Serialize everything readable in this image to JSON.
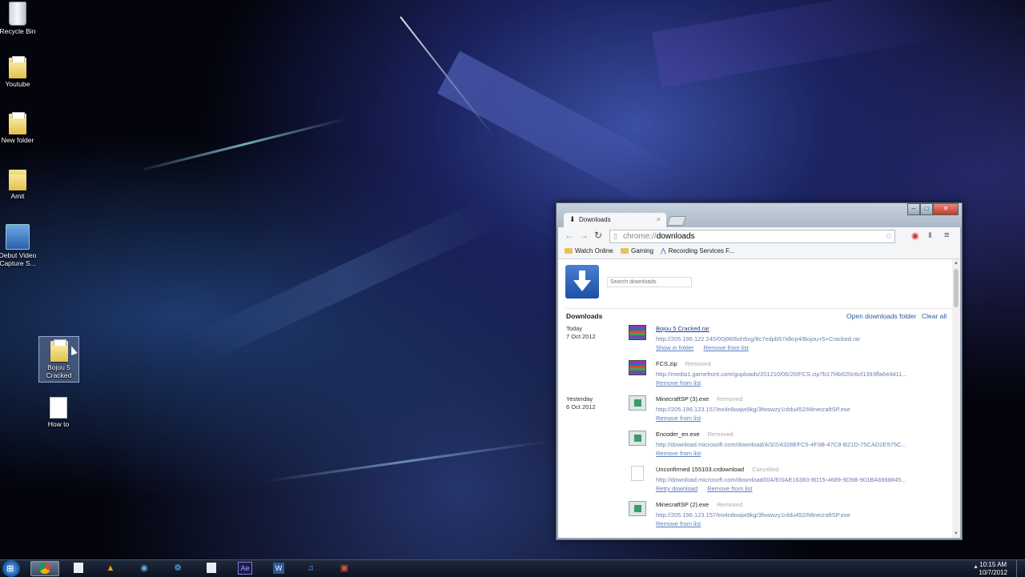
{
  "desktop": {
    "icons": [
      {
        "label": "Recycle Bin"
      },
      {
        "label": "Youtube"
      },
      {
        "label": "New folder"
      },
      {
        "label": "Amit"
      },
      {
        "label": "Debut Video Capture S..."
      },
      {
        "label": "Bojou 5 Cracked"
      },
      {
        "label": "How to"
      }
    ]
  },
  "browser": {
    "tab_title": "Downloads",
    "url_scheme": "chrome://",
    "url_path": "downloads",
    "bookmarks": [
      "Watch Online",
      "Gaming",
      "Recording Services F..."
    ],
    "search_placeholder": "Search downloads",
    "header_title": "Downloads",
    "open_folder": "Open downloads folder",
    "clear_all": "Clear all",
    "days": [
      {
        "label": "Today",
        "date": "7 Oct 2012"
      },
      {
        "label": "Yesterday",
        "date": "6 Oct 2012"
      }
    ],
    "items": [
      {
        "name": "Bojou 5 Cracked.rar",
        "status": "",
        "url": "http://205.196.122.245/00j9t06oh6xg/8c7edpb57idkrp4/Bojou+5+Cracked.rar",
        "actions": [
          "Show in folder",
          "Remove from list"
        ],
        "icon": "rar-icon"
      },
      {
        "name": "FCS.zip",
        "status": "Removed",
        "url": "http://media1.gamefront.com/guploads/201210/06/20/FCS.zip?b17f4b620c6cf1393ffa644d11...",
        "actions": [
          "Remove from list"
        ],
        "icon": "rar-icon"
      },
      {
        "name": "MinecraftSP (3).exe",
        "status": "Removed",
        "url": "http://205.196.123.157/eo4n8oajw9kg/3fwswzy1nldu452/MinecraftSP.exe",
        "actions": [
          "Remove from list"
        ],
        "icon": "exe-icon"
      },
      {
        "name": "Encoder_en.exe",
        "status": "Removed",
        "url": "http://download.microsoft.com/download/4/3/2/4328EFC5-4F3B-47C8-B21D-75CAD2E575C...",
        "actions": [
          "Remove from list"
        ],
        "icon": "exe-icon"
      },
      {
        "name": "Unconfirmed 155103.crdownload",
        "status": "Cancelled",
        "url": "http://download.microsoft.com/download/0/A/E/0AE16383-8D15-4689-9D9B-901BA6968845...",
        "actions": [
          "Retry download",
          "Remove from list"
        ],
        "icon": "blank-file-icon"
      },
      {
        "name": "MinecraftSP (2).exe",
        "status": "Removed",
        "url": "http://205.196.123.157/eo4n8oajw9kg/3fwswzy1nldu452/MinecraftSP.exe",
        "actions": [
          "Remove from list"
        ],
        "icon": "exe-icon"
      }
    ]
  },
  "taskbar": {
    "apps": [
      "chrome-icon",
      "app-icon",
      "vlc-icon",
      "media-icon",
      "photoshop-icon",
      "app-icon",
      "after-effects-icon",
      "word-icon",
      "itunes-icon",
      "app-icon"
    ],
    "ae_label": "Ae",
    "word_label": "W",
    "time": "10:15 AM",
    "date": "10/7/2012"
  },
  "colors": {
    "accent": "#2c5aa0",
    "link": "#1a3d8a",
    "status": "#aaaaaa"
  }
}
